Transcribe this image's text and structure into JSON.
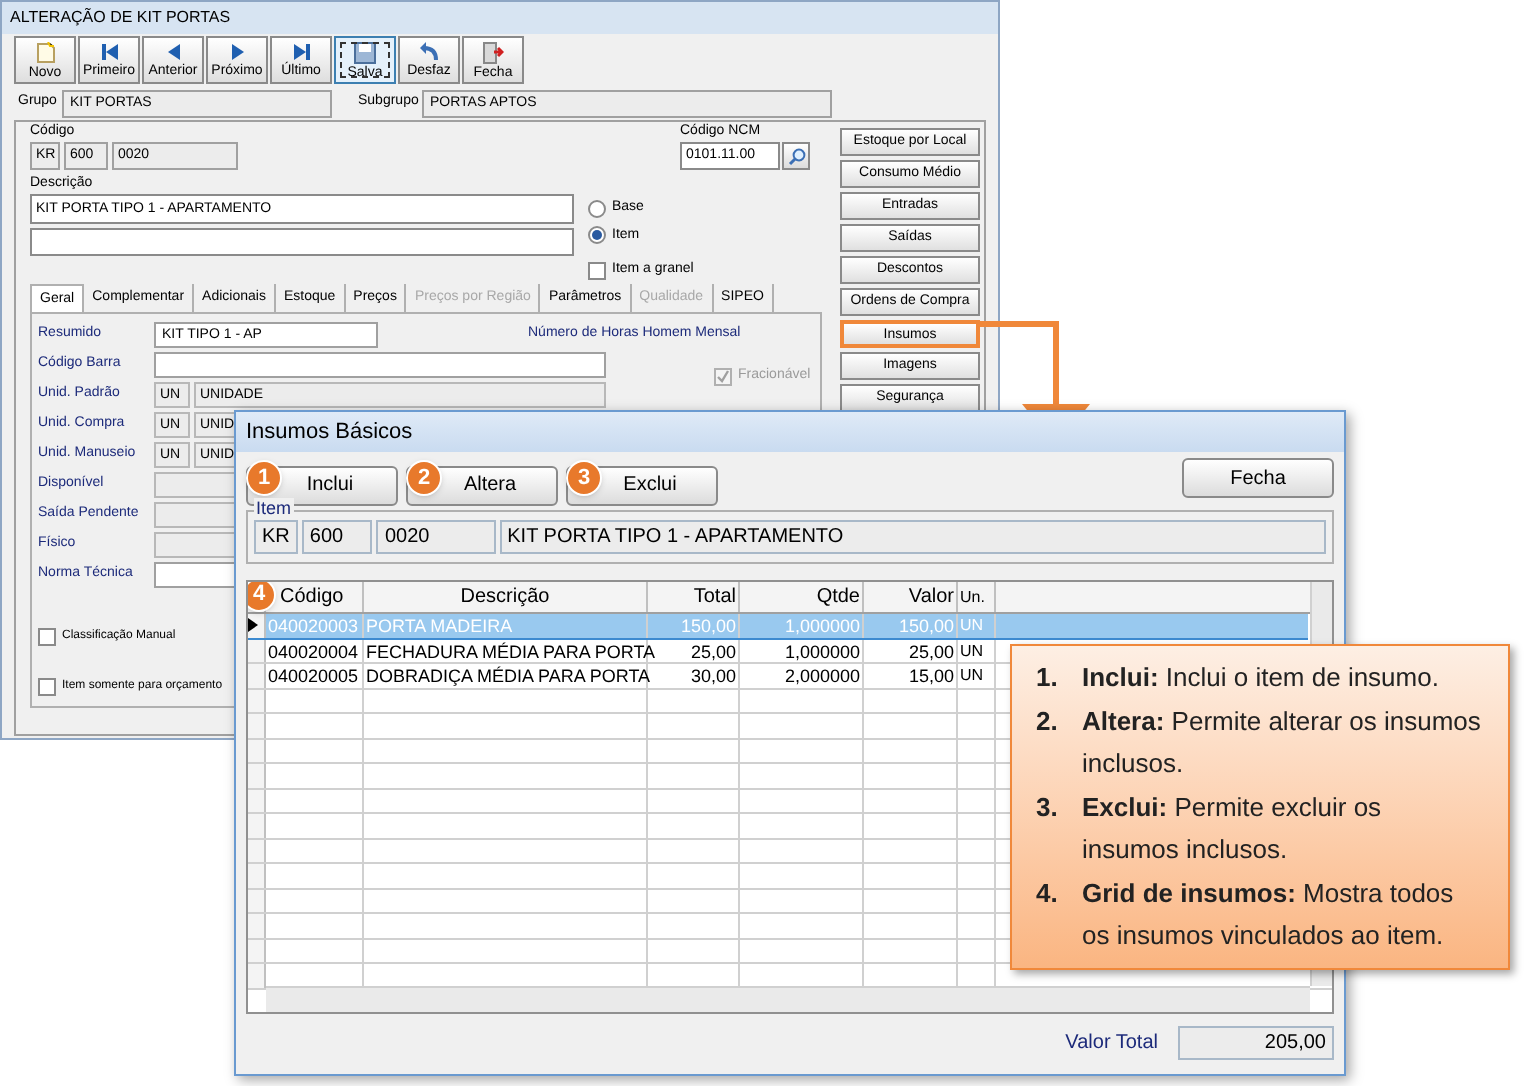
{
  "main_window": {
    "title": "ALTERAÇÃO DE KIT PORTAS",
    "toolbar": [
      {
        "label": "Novo",
        "kind": "new",
        "focused": false
      },
      {
        "label": "Primeiro",
        "kind": "first",
        "focused": false
      },
      {
        "label": "Anterior",
        "kind": "previous",
        "focused": false
      },
      {
        "label": "Próximo",
        "kind": "next",
        "focused": false
      },
      {
        "label": "Último",
        "kind": "last",
        "focused": false
      },
      {
        "label": "Salva",
        "kind": "save",
        "focused": true
      },
      {
        "label": "Desfaz",
        "kind": "undo",
        "focused": false
      },
      {
        "label": "Fecha",
        "kind": "close",
        "focused": false
      }
    ],
    "grupo": {
      "label": "Grupo",
      "value": "KIT PORTAS"
    },
    "subgrupo": {
      "label": "Subgrupo",
      "value": "PORTAS APTOS"
    },
    "codigo": {
      "label": "Código",
      "values": [
        "KR",
        "600",
        "0020"
      ]
    },
    "codigo_ncm": {
      "label": "Código NCM",
      "value": "0101.11.00"
    },
    "descricao": {
      "label": "Descrição",
      "value": "KIT PORTA TIPO 1 - APARTAMENTO"
    },
    "type_options": [
      {
        "label": "Base",
        "selected": false
      },
      {
        "label": "Item",
        "selected": true
      }
    ],
    "item_a_granel": {
      "label": "Item a granel",
      "checked": false
    },
    "tabs": [
      {
        "label": "Geral",
        "selected": true,
        "disabled": false
      },
      {
        "label": "Complementar",
        "selected": false,
        "disabled": false
      },
      {
        "label": "Adicionais",
        "selected": false,
        "disabled": false
      },
      {
        "label": "Estoque",
        "selected": false,
        "disabled": false
      },
      {
        "label": "Preços",
        "selected": false,
        "disabled": false
      },
      {
        "label": "Preços por Região",
        "selected": false,
        "disabled": true
      },
      {
        "label": "Parâmetros",
        "selected": false,
        "disabled": false
      },
      {
        "label": "Qualidade",
        "selected": false,
        "disabled": true
      },
      {
        "label": "SIPEO",
        "selected": false,
        "disabled": false
      }
    ],
    "fields": [
      {
        "label": "Resumido",
        "kind": "short",
        "values": [
          "KIT TIPO 1 - AP"
        ]
      },
      {
        "label": "Código Barra",
        "kind": "input"
      },
      {
        "label": "Unid. Padrão",
        "kind": "unit",
        "values": [
          "UN",
          "UNIDADE"
        ]
      },
      {
        "label": "Unid. Compra",
        "kind": "unit",
        "values": [
          "UN",
          "UNID"
        ]
      },
      {
        "label": "Unid. Manuseio",
        "kind": "unit",
        "values": [
          "UN",
          "UNID"
        ]
      },
      {
        "label": "Disponível",
        "kind": "readonly"
      },
      {
        "label": "Saída Pendente",
        "kind": "readonly"
      },
      {
        "label": "Físico",
        "kind": "readonly"
      },
      {
        "label": "Norma Técnica",
        "kind": "input"
      }
    ],
    "horas_label": "Número de Horas Homem Mensal",
    "fracionavel": {
      "label": "Fracionável",
      "checked": true,
      "disabled": true
    },
    "options": [
      {
        "label": "Classificação Manual",
        "checked": false
      },
      {
        "label": "Item somente para orçamento",
        "checked": false
      }
    ],
    "side_buttons": [
      {
        "label": "Estoque por Local",
        "highlighted": false
      },
      {
        "label": "Consumo Médio",
        "highlighted": false
      },
      {
        "label": "Entradas",
        "highlighted": false
      },
      {
        "label": "Saídas",
        "highlighted": false
      },
      {
        "label": "Descontos",
        "highlighted": false
      },
      {
        "label": "Ordens de Compra",
        "highlighted": false
      },
      {
        "label": "Insumos",
        "highlighted": true
      },
      {
        "label": "Imagens",
        "highlighted": false
      },
      {
        "label": "Segurança",
        "highlighted": false
      }
    ]
  },
  "dialog": {
    "title": "Insumos Básicos",
    "actions": [
      {
        "badge": "1",
        "label": "Inclui"
      },
      {
        "badge": "2",
        "label": "Altera"
      },
      {
        "badge": "3",
        "label": "Exclui"
      }
    ],
    "close_button": "Fecha",
    "item_group": {
      "legend": "Item",
      "values": [
        "KR",
        "600",
        "0020",
        "KIT PORTA TIPO 1 - APARTAMENTO"
      ]
    },
    "grid": {
      "badge": "4",
      "columns": [
        "Código",
        "Descrição",
        "Total",
        "Qtde",
        "Valor",
        "Un."
      ],
      "rows": [
        {
          "selected": true,
          "cells": [
            "040020003",
            "PORTA MADEIRA",
            "150,00",
            "1,000000",
            "150,00",
            "UN"
          ]
        },
        {
          "selected": false,
          "cells": [
            "040020004",
            "FECHADURA MÉDIA PARA PORTA",
            "25,00",
            "1,000000",
            "25,00",
            "UN"
          ]
        },
        {
          "selected": false,
          "cells": [
            "040020005",
            "DOBRADIÇA MÉDIA PARA PORTA",
            "30,00",
            "2,000000",
            "15,00",
            "UN"
          ]
        }
      ]
    },
    "total": {
      "label": "Valor Total",
      "value": "205,00"
    }
  },
  "callout": {
    "items": [
      {
        "number": "1.",
        "text": "**Inclui:** Inclui o item de insumo."
      },
      {
        "number": "2.",
        "text": "**Altera:** Permite alterar os insumos inclusos."
      },
      {
        "number": "3.",
        "text": "**Exclui:** Permite excluir os insumos inclusos."
      },
      {
        "number": "4.",
        "text": "**Grid de insumos:** Mostra todos os insumos vinculados ao item."
      }
    ]
  }
}
